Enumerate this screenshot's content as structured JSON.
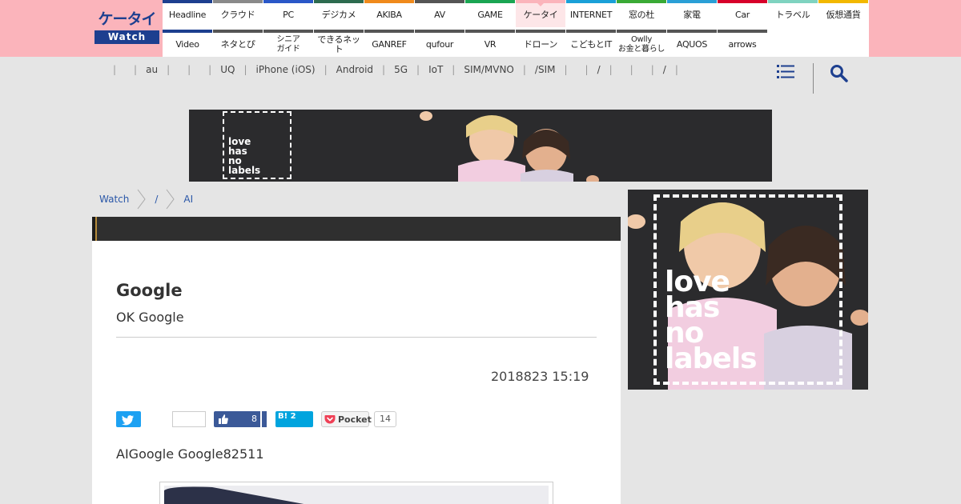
{
  "logo": {
    "line1": "ケータイ",
    "line2": "Watch"
  },
  "nav": {
    "row1": [
      {
        "label": "Headline",
        "color": "#1d3f8f"
      },
      {
        "label": "クラウド",
        "color": "#8a8a8a"
      },
      {
        "label": "PC",
        "color": "#2a57c8"
      },
      {
        "label": "デジカメ",
        "color": "#2d6b4f"
      },
      {
        "label": "AKIBA",
        "color": "#f08a1c"
      },
      {
        "label": "AV",
        "color": "#555555"
      },
      {
        "label": "GAME",
        "color": "#1aa552"
      },
      {
        "label": "ケータイ",
        "color": "#fbb4bb",
        "active": true
      },
      {
        "label": "INTERNET",
        "color": "#1aa0d8"
      },
      {
        "label": "窓の杜",
        "color": "#3aaa35"
      },
      {
        "label": "家電",
        "color": "#2a9fd6"
      },
      {
        "label": "Car",
        "color": "#d7002a"
      },
      {
        "label": "トラベル",
        "color": "#7fd3c0"
      },
      {
        "label": "仮想通貨",
        "color": "#f2b800"
      }
    ],
    "row2": [
      {
        "label": "Video",
        "color": "#1d3f8f"
      },
      {
        "label": "ネタとぴ",
        "color": "#555555"
      },
      {
        "label": "シニア\nガイド",
        "color": "#555555"
      },
      {
        "label": "できるネット",
        "color": "#555555"
      },
      {
        "label": "GANREF",
        "color": "#555555"
      },
      {
        "label": "qufour",
        "color": "#555555"
      },
      {
        "label": "VR",
        "color": "#555555"
      },
      {
        "label": "ドローン",
        "color": "#555555"
      },
      {
        "label": "こどもとIT",
        "color": "#555555"
      },
      {
        "label": "Owlly\nお金と暮らし",
        "color": "#555555"
      },
      {
        "label": "AQUOS",
        "color": "#555555"
      },
      {
        "label": "arrows",
        "color": "#555555"
      }
    ]
  },
  "subnav": {
    "items": [
      "",
      "au",
      "",
      "",
      "UQ",
      "iPhone (iOS)",
      "Android",
      "5G",
      "IoT",
      "SIM/MVNO",
      "/SIM",
      "",
      "/",
      "",
      "",
      "/",
      ""
    ]
  },
  "banner": {
    "text": "love\nhas\nno\nlabels"
  },
  "breadcrumb": {
    "items": [
      "Watch",
      "/",
      "AI"
    ]
  },
  "article": {
    "title": "Google",
    "subtitle": "OK Google",
    "date": "2018823 15:19",
    "lead": "AIGoogle Google82511"
  },
  "share": {
    "facebook_count": "8",
    "hatena_label": "B!",
    "hatena_count": "2",
    "pocket_label": "Pocket",
    "pocket_count": "14"
  },
  "sidead": {
    "text": "love\nhas\nno\nlabels"
  }
}
